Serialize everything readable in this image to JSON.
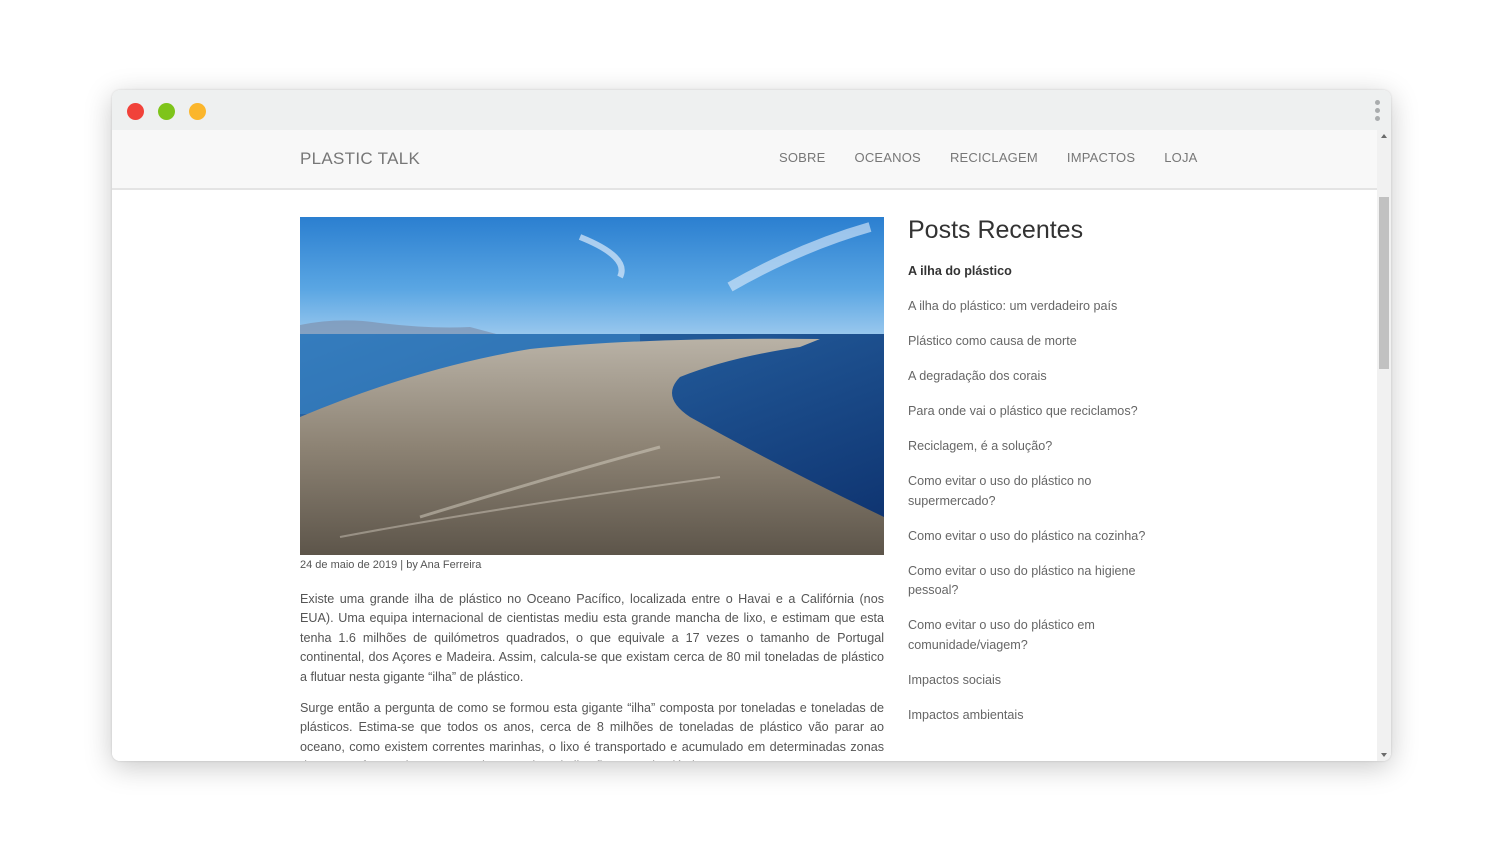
{
  "window": {
    "controls": [
      "close",
      "minimize",
      "maximize"
    ]
  },
  "navbar": {
    "brand": "PLASTIC TALK",
    "links": [
      "SOBRE",
      "OCEANOS",
      "RECICLAGEM",
      "IMPACTOS",
      "LOJA"
    ]
  },
  "article": {
    "image_alt": "Ilha de plástico no oceano",
    "meta": "24 de maio de 2019 | by Ana Ferreira",
    "paragraphs": [
      "Existe uma grande ilha de plástico no Oceano Pacífico, localizada entre o Havai e a Califórnia (nos EUA). Uma equipa internacional de cientistas mediu esta grande mancha de lixo, e estimam que esta tenha 1.6 milhões de quilómetros quadrados, o que equivale a 17 vezes o tamanho de Portugal continental, dos Açores e Madeira. Assim, calcula-se que existam cerca de 80 mil toneladas de plástico a flutuar nesta gigante “ilha” de plástico.",
      "Surge então a pergunta de como se formou esta gigante “ilha” composta por toneladas e toneladas de plásticos. Estima-se que todos os anos, cerca de 8 milhões de toneladas de plástico vão parar ao oceano, como existem correntes marinhas, o lixo é transportado e acumulado em determinadas zonas do oceano formando estas grandes manchas de lixo flutuante de plástico."
    ]
  },
  "sidebar": {
    "title": "Posts Recentes",
    "posts": [
      "A ilha do plástico",
      "A ilha do plástico: um verdadeiro país",
      "Plástico como causa de morte",
      "A degradação dos corais",
      "Para onde vai o plástico que reciclamos?",
      "Reciclagem, é a solução?",
      "Como evitar o uso do plástico no supermercado?",
      "Como evitar o uso do plástico na cozinha?",
      "Como evitar o uso do plástico na higiene pessoal?",
      "Como evitar o uso do plástico em comunidade/viagem?",
      "Impactos sociais",
      "Impactos ambientais"
    ]
  },
  "colors": {
    "close": "#f1423a",
    "minimize": "#7ec41a",
    "maximize": "#fbb62c",
    "navbar_bg": "#f8f8f8",
    "text": "#555555"
  },
  "icons": [
    "kebab-menu-icon",
    "scroll-up-icon",
    "scroll-down-icon"
  ]
}
